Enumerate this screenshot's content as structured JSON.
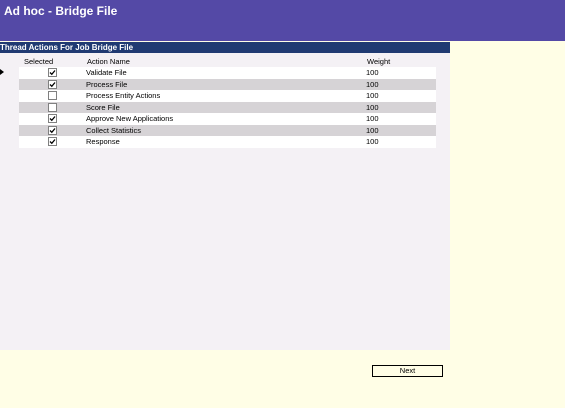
{
  "header": {
    "title": "Ad hoc - Bridge File"
  },
  "panel": {
    "title": "Thread Actions For Job Bridge File",
    "columns": {
      "selected": "Selected",
      "action_name": "Action Name",
      "weight": "Weight"
    },
    "rows": [
      {
        "selected": true,
        "action_name": "Validate File",
        "weight": "100"
      },
      {
        "selected": true,
        "action_name": "Process File",
        "weight": "100"
      },
      {
        "selected": false,
        "action_name": "Process Entity Actions",
        "weight": "100"
      },
      {
        "selected": false,
        "action_name": "Score File",
        "weight": "100"
      },
      {
        "selected": true,
        "action_name": "Approve New Applications",
        "weight": "100"
      },
      {
        "selected": true,
        "action_name": "Collect Statistics",
        "weight": "100"
      },
      {
        "selected": true,
        "action_name": "Response",
        "weight": "100"
      }
    ]
  },
  "footer": {
    "next_label": "Next"
  },
  "colors": {
    "title_bar": "#5449A6",
    "panel_header": "#203A72",
    "page_background": "#FFFEE6",
    "panel_background": "#F4F1F5",
    "alt_row": "#D6D3D6"
  }
}
